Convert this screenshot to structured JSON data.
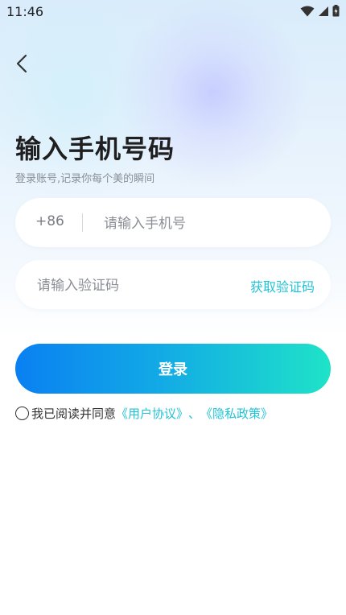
{
  "status_bar": {
    "time": "11:46"
  },
  "header": {
    "title": "输入手机号码",
    "subtitle": "登录账号,记录你每个美的瞬间"
  },
  "phone_field": {
    "prefix": "+86",
    "placeholder": "请输入手机号",
    "value": ""
  },
  "code_field": {
    "placeholder": "请输入验证码",
    "value": "",
    "get_code_label": "获取验证码"
  },
  "login_button": {
    "label": "登录"
  },
  "agreement": {
    "checked": false,
    "text": "我已阅读并同意",
    "user_agreement": "《用户协议》",
    "separator": "、",
    "privacy_policy": "《隐私政策》"
  },
  "colors": {
    "accent": "#21c3d6",
    "button_gradient_start": "#0a80f2",
    "button_gradient_end": "#1fe3c8"
  },
  "icons": [
    "wifi-icon",
    "signal-icon",
    "battery-icon",
    "back-arrow-icon"
  ]
}
